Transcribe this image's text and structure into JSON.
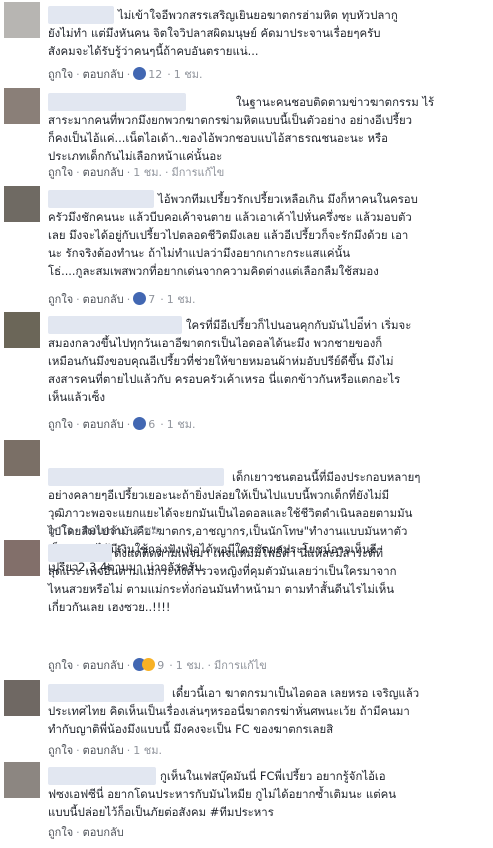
{
  "comments": [
    {
      "text": "ไม่เข้าใจอีพวกสรรเสริญเยินยอฆาตกรฮ่ามหิต ทุบหัวปลากู\nยังไม่ทำ แต่มึงหันคน จิตใจวิปลาสผิดมนุษย์ คัดมาประจานเรื่อยๆครับ\nสังคมจะได้รับรู้ว่าคนๆนี้ถ้าคบอันตรายแน่...",
      "like": "ถูกใจ",
      "reply": "ตอบกลับ",
      "reactions": "12",
      "time": "1 ชม.",
      "edited": ""
    },
    {
      "text": "ในฐานะคนชอบติดตามข่าวฆาตกรรม ไร้\nสาระมากคนที่พวกมึงยกพวกฆาตกรฆ่ามหิตแบบนี้เป็นตัวอย่าง อย่างอีเปรี้ยว\nก็คงเป็นไอ้แค่...เน็ตไอเด้า..ของไอ้พวกชอบแบไอ้สาธรณชนอะนะ หรือ\nประเภทเด็กกันไม่เลือกหน้าแค่นั้นอะ",
      "like": "ถูกใจ",
      "reply": "ตอบกลับ",
      "reactions": "",
      "time": "1 ชม.",
      "edited": "มีการแก้ไข"
    },
    {
      "text": "ไอ้พวกทีมเปรี้ยวรักเปรี้ยวเหลือเกิน มึงก็หาคนในครอบ\nครัวมึงชักคนนะ แล้วบีบคอเค้าจนตาย แล้วเอาเค้าไปหั่นครึ่งซะ แล้วมอบตัว\nเลย มึงจะได้อยู่กับเปรี้ยวไปตลอดชีวิตมึงเลย แล้วอีเปรี้ยวก็จะรักมึงด้วย เอา\nนะ รักจริงต้องทำนะ ถ้าไม่ทำแปลว่ามึงอยากเกาะกระแสแค่นั้น\nโธ่....กูละสมเพสพวกที่อยากเด่นจากความคิดต่างแต่เลือกลืมใช้สมอง",
      "like": "ถูกใจ",
      "reply": "ตอบกลับ",
      "reactions": "7",
      "time": "1 ชม.",
      "edited": ""
    },
    {
      "text": "ใครที่มีอีเปรี้ยวก็ไปนอนคุกกับมันไปอ่ีห่า เริ่มจะ\nสมองกลวงขึ้นไปทุกวันเอาอีฆาตกรเป็นไอดอลได้นะมึง พวกชายของก็\nเหมือนกันมึงขอบคุณอีเปรี้ยวที่ช่วยให้ขายหมอนผ้าห่มอับปรีย์ดีขึ้น มึงไม่\nสงสารคนที่ตายไปแล้วกับ ครอบครัวเค้าเหรอ นี่แตกข้าวกันหรือแตกอะไร\nเห็นแล้วเซ็ง",
      "like": "ถูกใจ",
      "reply": "ตอบกลับ",
      "reactions": "6",
      "time": "1 ชม.",
      "edited": ""
    },
    {
      "text": "เด็กเยาวชนตอนนี้ที่มีองประกอบหลายๆ\nอย่างคลายๆอีเปรี้ยวเยอะนะถ้ายิ่งปล่อยให้เป็นไปแบบนี้พวกเด็กที่ยังไม่มี\nวุฒิภาวะพอจะแยกแยะได้จะยกมันเป็นไอดอลและใช้ชีวิตดำเนินลอยตามมัน\nไปโดยลืมไปว่ามันคือ\"ฆาตกร,อาชญากร,เป็นนักโทษ\"ทำงานแบบมันหาตัว\nเป็นเอาจะได้มีเงินใช้กลุ่งฟังเฟ้อได้พอมีใครชัดผลประโยชน์อาจเห็นอี\nเปรี้ยว2,3,4ตามมา น่ากลัวครับ",
      "like": "ถูกใจ",
      "reply": "ตอบกลับ",
      "reactions": "",
      "time": "1 ชม.",
      "edited": ""
    },
    {
      "text": "ตั้งแต่ติดตามเพจมา เพจแหม่มโพธิ์ดำ นี่แหละมีสาระดีที่\nสุดแระ เพจอื่นตามแม่กระทั่งตำรวจหญิงที่คุมตัวมันเลยว่าเป็นใครมาจาก\nไหนสวยหรือไม่ ตามแม่กระทั่งก่อนมันทำหน้ามา ตามทำสั้นดีนไรไม่เห็น\nเกี่ยวกันเลย เฮงซวย..!!!!",
      "like": "ถูกใจ",
      "reply": "ตอบกลับ",
      "reactions": "9",
      "time": "1 ชม.",
      "edited": "มีการแก้ไข"
    },
    {
      "text": "เดี๋ยวนี้เอา ฆาตกรมาเป็นไอดอล เลยหรอ เจริญแล้ว\nประเทศไทย คิดเห็นเป็นเรื่องเล่นๆหรออนี่ฆาตกรฆ่าหั่นศพนะเว้ย ถ้ามีคนมา\nทำกับญาติพี่น้องมึงแบบนี้ มึงคงจะเป็น FC ของฆาตกรเลยสิ",
      "like": "ถูกใจ",
      "reply": "ตอบกลับ",
      "reactions": "",
      "time": "1 ชม.",
      "edited": ""
    },
    {
      "text": "กูเห็นในเฟสบุ๊คมันนี่ FCพี่เปรี้ยว อยากรู้จักไอ้เอ\nฟซงเอฟซีนี่ อยากโดนประหารกับมันไหมีย กูไม่ได้อยากซ้ำเติมนะ แต่คน\nแบบนี้ปล่อยไว้ก็อเป็นภัยต่อสังคม #ทีมประหาร",
      "like": "ถูกใจ",
      "reply": "ตอบกลับ",
      "reactions": "",
      "time": "",
      "edited": ""
    }
  ],
  "colors": {
    "name_highlight": "#e2e7f1",
    "meta": "#90949c",
    "text": "#1d2129",
    "link": "#4b4f56",
    "like": "#4267b2",
    "haha": "#f7b125"
  },
  "icons": {
    "reaction_like": "thumbs-up-icon",
    "reaction_haha": "haha-icon"
  }
}
